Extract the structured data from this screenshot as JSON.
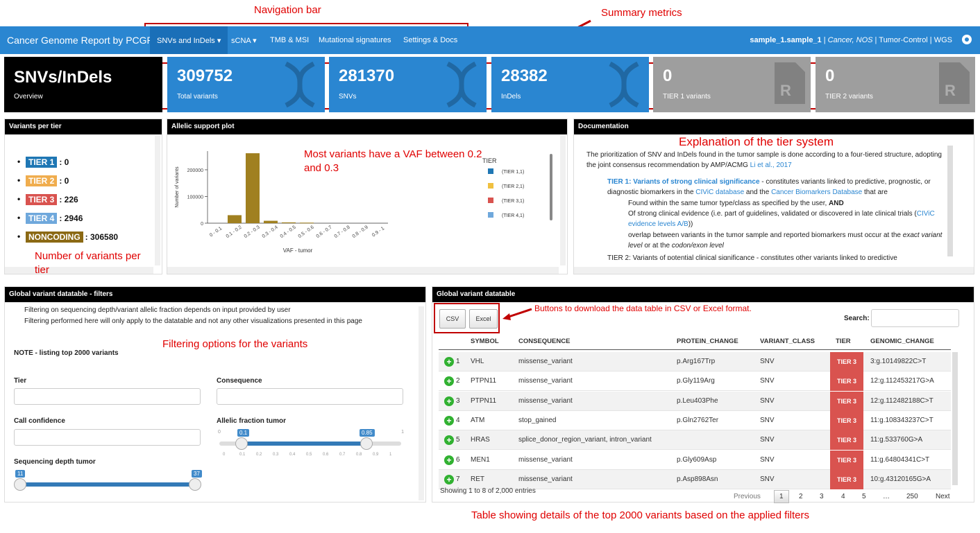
{
  "annotations": {
    "navigation_bar": "Navigation bar",
    "summary_metrics": "Summary metrics",
    "tier_explanation": "Explanation of the tier system",
    "vaf_note": "Most variants have a VAF between 0.2 and 0.3",
    "variants_per_tier_note": "Number of variants per tier",
    "filter_note": "Filtering options for the variants",
    "download_note": "Buttons to download the data table in CSV or Excel format.",
    "table_note": "Table showing details of the top 2000 variants based on the applied filters"
  },
  "navbar": {
    "brand": "Cancer Genome Report by PCGR",
    "items": [
      "SNVs and InDels ▾",
      "sCNA ▾",
      "TMB & MSI",
      "Mutational signatures",
      "Settings & Docs"
    ],
    "sample": "sample_1.sample_1",
    "sep1": " | ",
    "cancer": "Cancer, NOS",
    "rest": " | Tumor-Control | WGS",
    "colors": {
      "bar": "#2a86d1",
      "active": "#1a6fb8"
    }
  },
  "summary": {
    "overview_title": "SNVs/InDels",
    "overview_sub": "Overview",
    "boxes": [
      {
        "value": "309752",
        "label": "Total variants"
      },
      {
        "value": "281370",
        "label": "SNVs"
      },
      {
        "value": "28382",
        "label": "InDels"
      },
      {
        "value": "0",
        "label": "TIER 1 variants"
      },
      {
        "value": "0",
        "label": "TIER 2 variants"
      }
    ]
  },
  "tiers_panel": {
    "title": "Variants per tier",
    "rows": [
      {
        "badge": "TIER 1",
        "value": ": 0",
        "color": "#1f77b4"
      },
      {
        "badge": "TIER 2",
        "value": ": 0",
        "color": "#f0ad4e"
      },
      {
        "badge": "TIER 3",
        "value": ": 226",
        "color": "#d9534f"
      },
      {
        "badge": "TIER 4",
        "value": ": 2946",
        "color": "#5bc0de"
      },
      {
        "badge": "NONCODING",
        "value": ": 306580",
        "color": "#8b6914"
      }
    ]
  },
  "allelic_panel": {
    "title": "Allelic support plot",
    "chart_data": {
      "type": "bar",
      "categories": [
        "0 - 0.1",
        "0.1 - 0.2",
        "0.2 - 0.3",
        "0.3 - 0.4",
        "0.4 - 0.5",
        "0.5 - 0.6",
        "0.6 - 0.7",
        "0.7 - 0.8",
        "0.8 - 0.9",
        "0.9 - 1"
      ],
      "values": [
        0,
        30000,
        262000,
        9000,
        3000,
        2000,
        0,
        0,
        0,
        0
      ],
      "xlabel": "VAF - tumor",
      "ylabel": "Number of variants",
      "yticks": [
        "0",
        "100000",
        "200000"
      ],
      "ylim": [
        0,
        270000
      ],
      "bar_color": "#a08020",
      "legend_title": "TIER",
      "legend": [
        {
          "label": "(TIER 1,1)",
          "color": "#1f77b4"
        },
        {
          "label": "(TIER 2,1)",
          "color": "#f0c040"
        },
        {
          "label": "(TIER 3,1)",
          "color": "#d9534f"
        },
        {
          "label": "(TIER 4,1)",
          "color": "#6fa8dc"
        }
      ]
    }
  },
  "doc_panel": {
    "title": "Documentation",
    "intro": "The prioritization of SNV and InDels found in the tumor sample is done according to a four-tiered structure, adopting the joint consensus recommendation by AMP/ACMG ",
    "intro_link": "Li et al., 2017",
    "tier1_title": "TIER 1: Variants of strong clinical significance",
    "tier1_text": " - constitutes variants linked to predictive, prognostic, or diagnostic biomarkers in the ",
    "civic": "CIViC database",
    "and": " and the ",
    "cbd": "Cancer Biomarkers Database",
    "that_are": " that are",
    "sub1a": "Found within the same tumor type/class as specified by the user, ",
    "sub1b": "AND",
    "sub2": "Of strong clinical evidence (i.e. part of guidelines, validated or discovered in late clinical trials (",
    "sub2_link": "CIViC evidence levels A/B",
    "sub2_end": "))",
    "sub3a": "overlap between variants in the tumor sample and reported biomarkers must occur at the ",
    "sub3b": "exact variant level",
    "sub3c": " or at the ",
    "sub3d": "codon/exon level",
    "tier2_partial": "TIER 2: Variants of potential clinical significance - constitutes other variants linked to predictive"
  },
  "filters_panel": {
    "title": "Global variant datatable - filters",
    "bullet1": "Filtering on sequencing depth/variant allelic fraction depends on input provided by user",
    "bullet2": "Filtering performed here will only apply to the datatable and not any other visualizations presented in this page",
    "note": "NOTE - listing top 2000 variants",
    "tier_label": "Tier",
    "consequence_label": "Consequence",
    "confidence_label": "Call confidence",
    "af_label": "Allelic fraction tumor",
    "af_min": "0",
    "af_max": "1",
    "af_low": "0.1",
    "af_high": "0.85",
    "af_low_value": 0.1,
    "af_high_value": 0.85,
    "af_ticks": [
      "0",
      "0.1",
      "0.2",
      "0.3",
      "0.4",
      "0.5",
      "0.6",
      "0.7",
      "0.8",
      "0.9",
      "1"
    ],
    "depth_label": "Sequencing depth tumor",
    "depth_low": "11",
    "depth_high": "37"
  },
  "table_panel": {
    "title": "Global variant datatable",
    "csv": "CSV",
    "excel": "Excel",
    "search_label": "Search:",
    "columns": [
      "SYMBOL",
      "CONSEQUENCE",
      "PROTEIN_CHANGE",
      "VARIANT_CLASS",
      "TIER",
      "GENOMIC_CHANGE"
    ],
    "rows": [
      {
        "n": "1",
        "symbol": "VHL",
        "consequence": "missense_variant",
        "protein": "p.Arg167Trp",
        "vclass": "SNV",
        "tier": "TIER 3",
        "genomic": "3:g.10149822C>T"
      },
      {
        "n": "2",
        "symbol": "PTPN11",
        "consequence": "missense_variant",
        "protein": "p.Gly119Arg",
        "vclass": "SNV",
        "tier": "TIER 3",
        "genomic": "12:g.112453217G>A"
      },
      {
        "n": "3",
        "symbol": "PTPN11",
        "consequence": "missense_variant",
        "protein": "p.Leu403Phe",
        "vclass": "SNV",
        "tier": "TIER 3",
        "genomic": "12:g.112482188C>T"
      },
      {
        "n": "4",
        "symbol": "ATM",
        "consequence": "stop_gained",
        "protein": "p.Gln2762Ter",
        "vclass": "SNV",
        "tier": "TIER 3",
        "genomic": "11:g.108343237C>T"
      },
      {
        "n": "5",
        "symbol": "HRAS",
        "consequence": "splice_donor_region_variant, intron_variant",
        "protein": "",
        "vclass": "SNV",
        "tier": "TIER 3",
        "genomic": "11:g.533760G>A"
      },
      {
        "n": "6",
        "symbol": "MEN1",
        "consequence": "missense_variant",
        "protein": "p.Gly609Asp",
        "vclass": "SNV",
        "tier": "TIER 3",
        "genomic": "11:g.64804341C>T"
      },
      {
        "n": "7",
        "symbol": "RET",
        "consequence": "missense_variant",
        "protein": "p.Asp898Asn",
        "vclass": "SNV",
        "tier": "TIER 3",
        "genomic": "10:g.43120165G>A"
      }
    ],
    "showing": "Showing 1 to 8 of 2,000 entries",
    "pager": [
      "Previous",
      "1",
      "2",
      "3",
      "4",
      "5",
      "…",
      "250",
      "Next"
    ]
  }
}
